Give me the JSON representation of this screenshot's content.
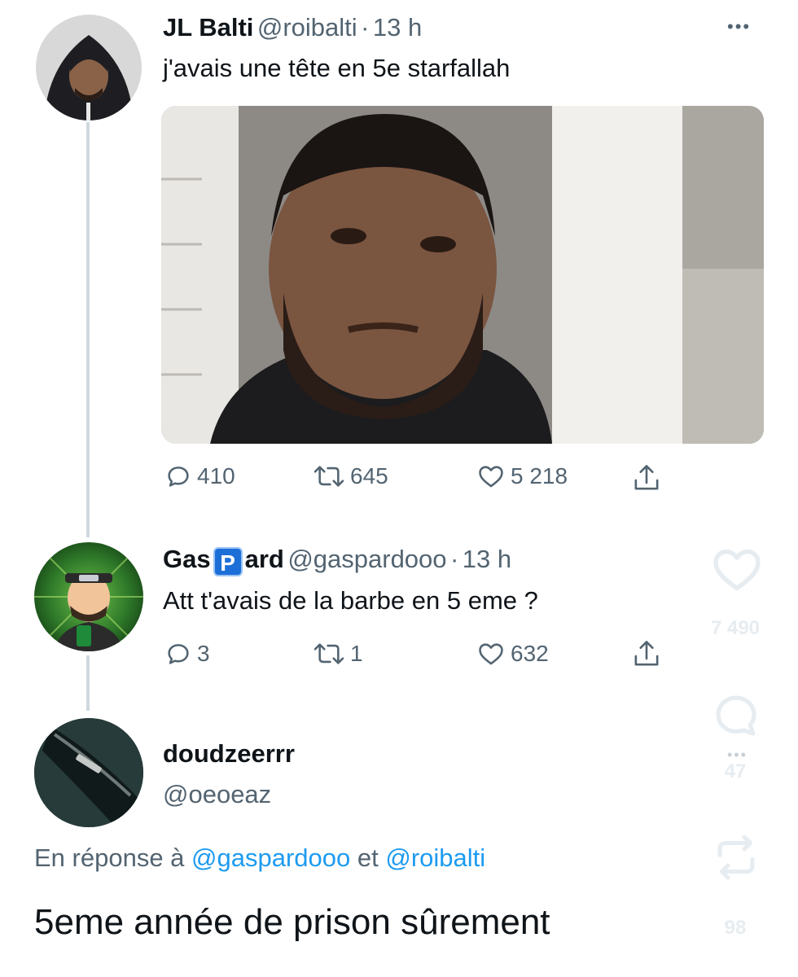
{
  "tweet1": {
    "name": "JL Balti",
    "handle": "@roibalti",
    "time": "13 h",
    "text": "j'avais une tête en 5e starfallah",
    "replies": "410",
    "retweets": "645",
    "likes": "5 218",
    "more": "•••"
  },
  "tweet2": {
    "name_pre": "Gas",
    "name_badge": "P",
    "name_post": "ard",
    "handle": "@gaspardooo",
    "time": "13 h",
    "text": "Att t'avais de la barbe en 5 eme ?",
    "replies": "3",
    "retweets": "1",
    "likes": "632"
  },
  "tweet3": {
    "name": "doudzeerrr",
    "handle": "@oeoeaz",
    "reply_prefix": "En réponse à",
    "reply_to_1": "@gaspardooo",
    "reply_join": "et",
    "reply_to_2": "@roibalti",
    "text": "5eme année de prison sûrement"
  },
  "overlay": {
    "likes": "7 490",
    "comments": "47",
    "reposts": "98",
    "more": "•••"
  },
  "colors": {
    "text": "#0f1419",
    "secondary": "#536471",
    "link": "#1d9bf0",
    "thread_line": "#cfd9de"
  }
}
